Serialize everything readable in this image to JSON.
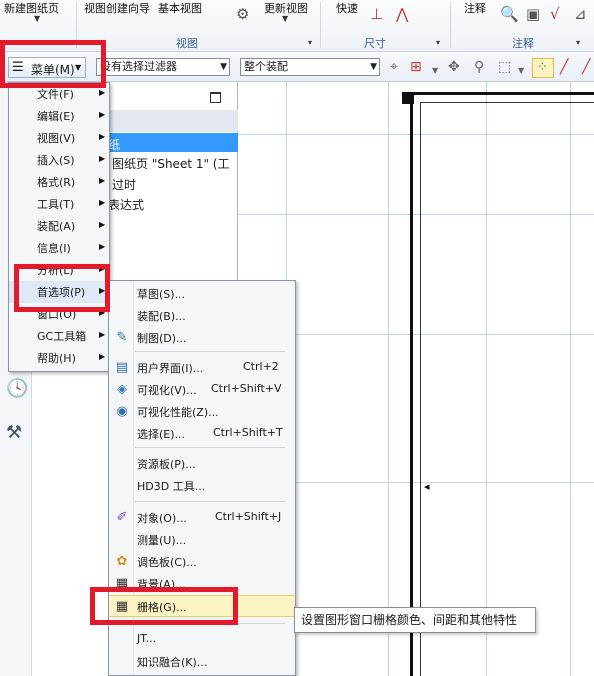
{
  "ribbon": {
    "new_drawing_sheet": "新建图纸页",
    "view_wizard": "视图创建向导",
    "base_view": "基本视图",
    "update_view": "更新视图",
    "quick": "快速",
    "annotation": "注释",
    "group_view": "视图",
    "group_dimension": "尺寸",
    "group_annotation": "注释"
  },
  "toolbar": {
    "menu_button": "菜单(M)",
    "filter_combo": "没有选择过滤器",
    "assembly_combo": "整个装配"
  },
  "navigator": {
    "rows": [
      "纸",
      "图纸页 \"Sheet 1\" (工",
      "过时",
      "表达式"
    ]
  },
  "main_menu": {
    "items": [
      {
        "label": "文件(F)",
        "has_submenu": true
      },
      {
        "label": "编辑(E)",
        "has_submenu": true
      },
      {
        "label": "视图(V)",
        "has_submenu": true
      },
      {
        "label": "插入(S)",
        "has_submenu": true
      },
      {
        "label": "格式(R)",
        "has_submenu": true
      },
      {
        "label": "工具(T)",
        "has_submenu": true
      },
      {
        "label": "装配(A)",
        "has_submenu": true
      },
      {
        "label": "信息(I)",
        "has_submenu": true
      },
      {
        "label": "分析(L)",
        "has_submenu": true
      },
      {
        "label": "首选项(P)",
        "has_submenu": true
      },
      {
        "label": "窗口(O)",
        "has_submenu": true
      },
      {
        "label": "GC工具箱",
        "has_submenu": true
      },
      {
        "label": "帮助(H)",
        "has_submenu": true
      }
    ]
  },
  "pref_menu": {
    "items": [
      {
        "label": "草图(S)...",
        "shortcut": "",
        "icon": "none"
      },
      {
        "label": "装配(B)...",
        "shortcut": "",
        "icon": "none"
      },
      {
        "label": "制图(D)...",
        "shortcut": "",
        "icon": "drafting-pen-icon"
      },
      {
        "label": "用户界面(I)...",
        "shortcut": "Ctrl+2",
        "icon": "user-interface-icon"
      },
      {
        "label": "可视化(V)...",
        "shortcut": "Ctrl+Shift+V",
        "icon": "visualization-icon"
      },
      {
        "label": "可视化性能(Z)...",
        "shortcut": "",
        "icon": "visualization-performance-icon"
      },
      {
        "label": "选择(E)...",
        "shortcut": "Ctrl+Shift+T",
        "icon": "none"
      },
      {
        "label": "资源板(P)...",
        "shortcut": "",
        "icon": "none"
      },
      {
        "label": "HD3D 工具...",
        "shortcut": "",
        "icon": "none"
      },
      {
        "label": "对象(O)...",
        "shortcut": "Ctrl+Shift+J",
        "icon": "object-brush-icon"
      },
      {
        "label": "测量(U)...",
        "shortcut": "",
        "icon": "none"
      },
      {
        "label": "调色板(C)...",
        "shortcut": "",
        "icon": "palette-icon"
      },
      {
        "label": "背景(A)...",
        "shortcut": "",
        "icon": "background-icon"
      },
      {
        "label": "栅格(G)...",
        "shortcut": "",
        "icon": "grid-icon"
      },
      {
        "label": "JT...",
        "shortcut": "",
        "icon": "none"
      },
      {
        "label": "知识融合(K)...",
        "shortcut": "",
        "icon": "none"
      }
    ]
  },
  "tooltip": {
    "text": "设置图形窗口栅格颜色、间距和其他特性"
  },
  "colors": {
    "highlight_red": "#e21a2c",
    "selection_blue": "#3399ff",
    "hover_yellow": "#fdf4c4"
  }
}
